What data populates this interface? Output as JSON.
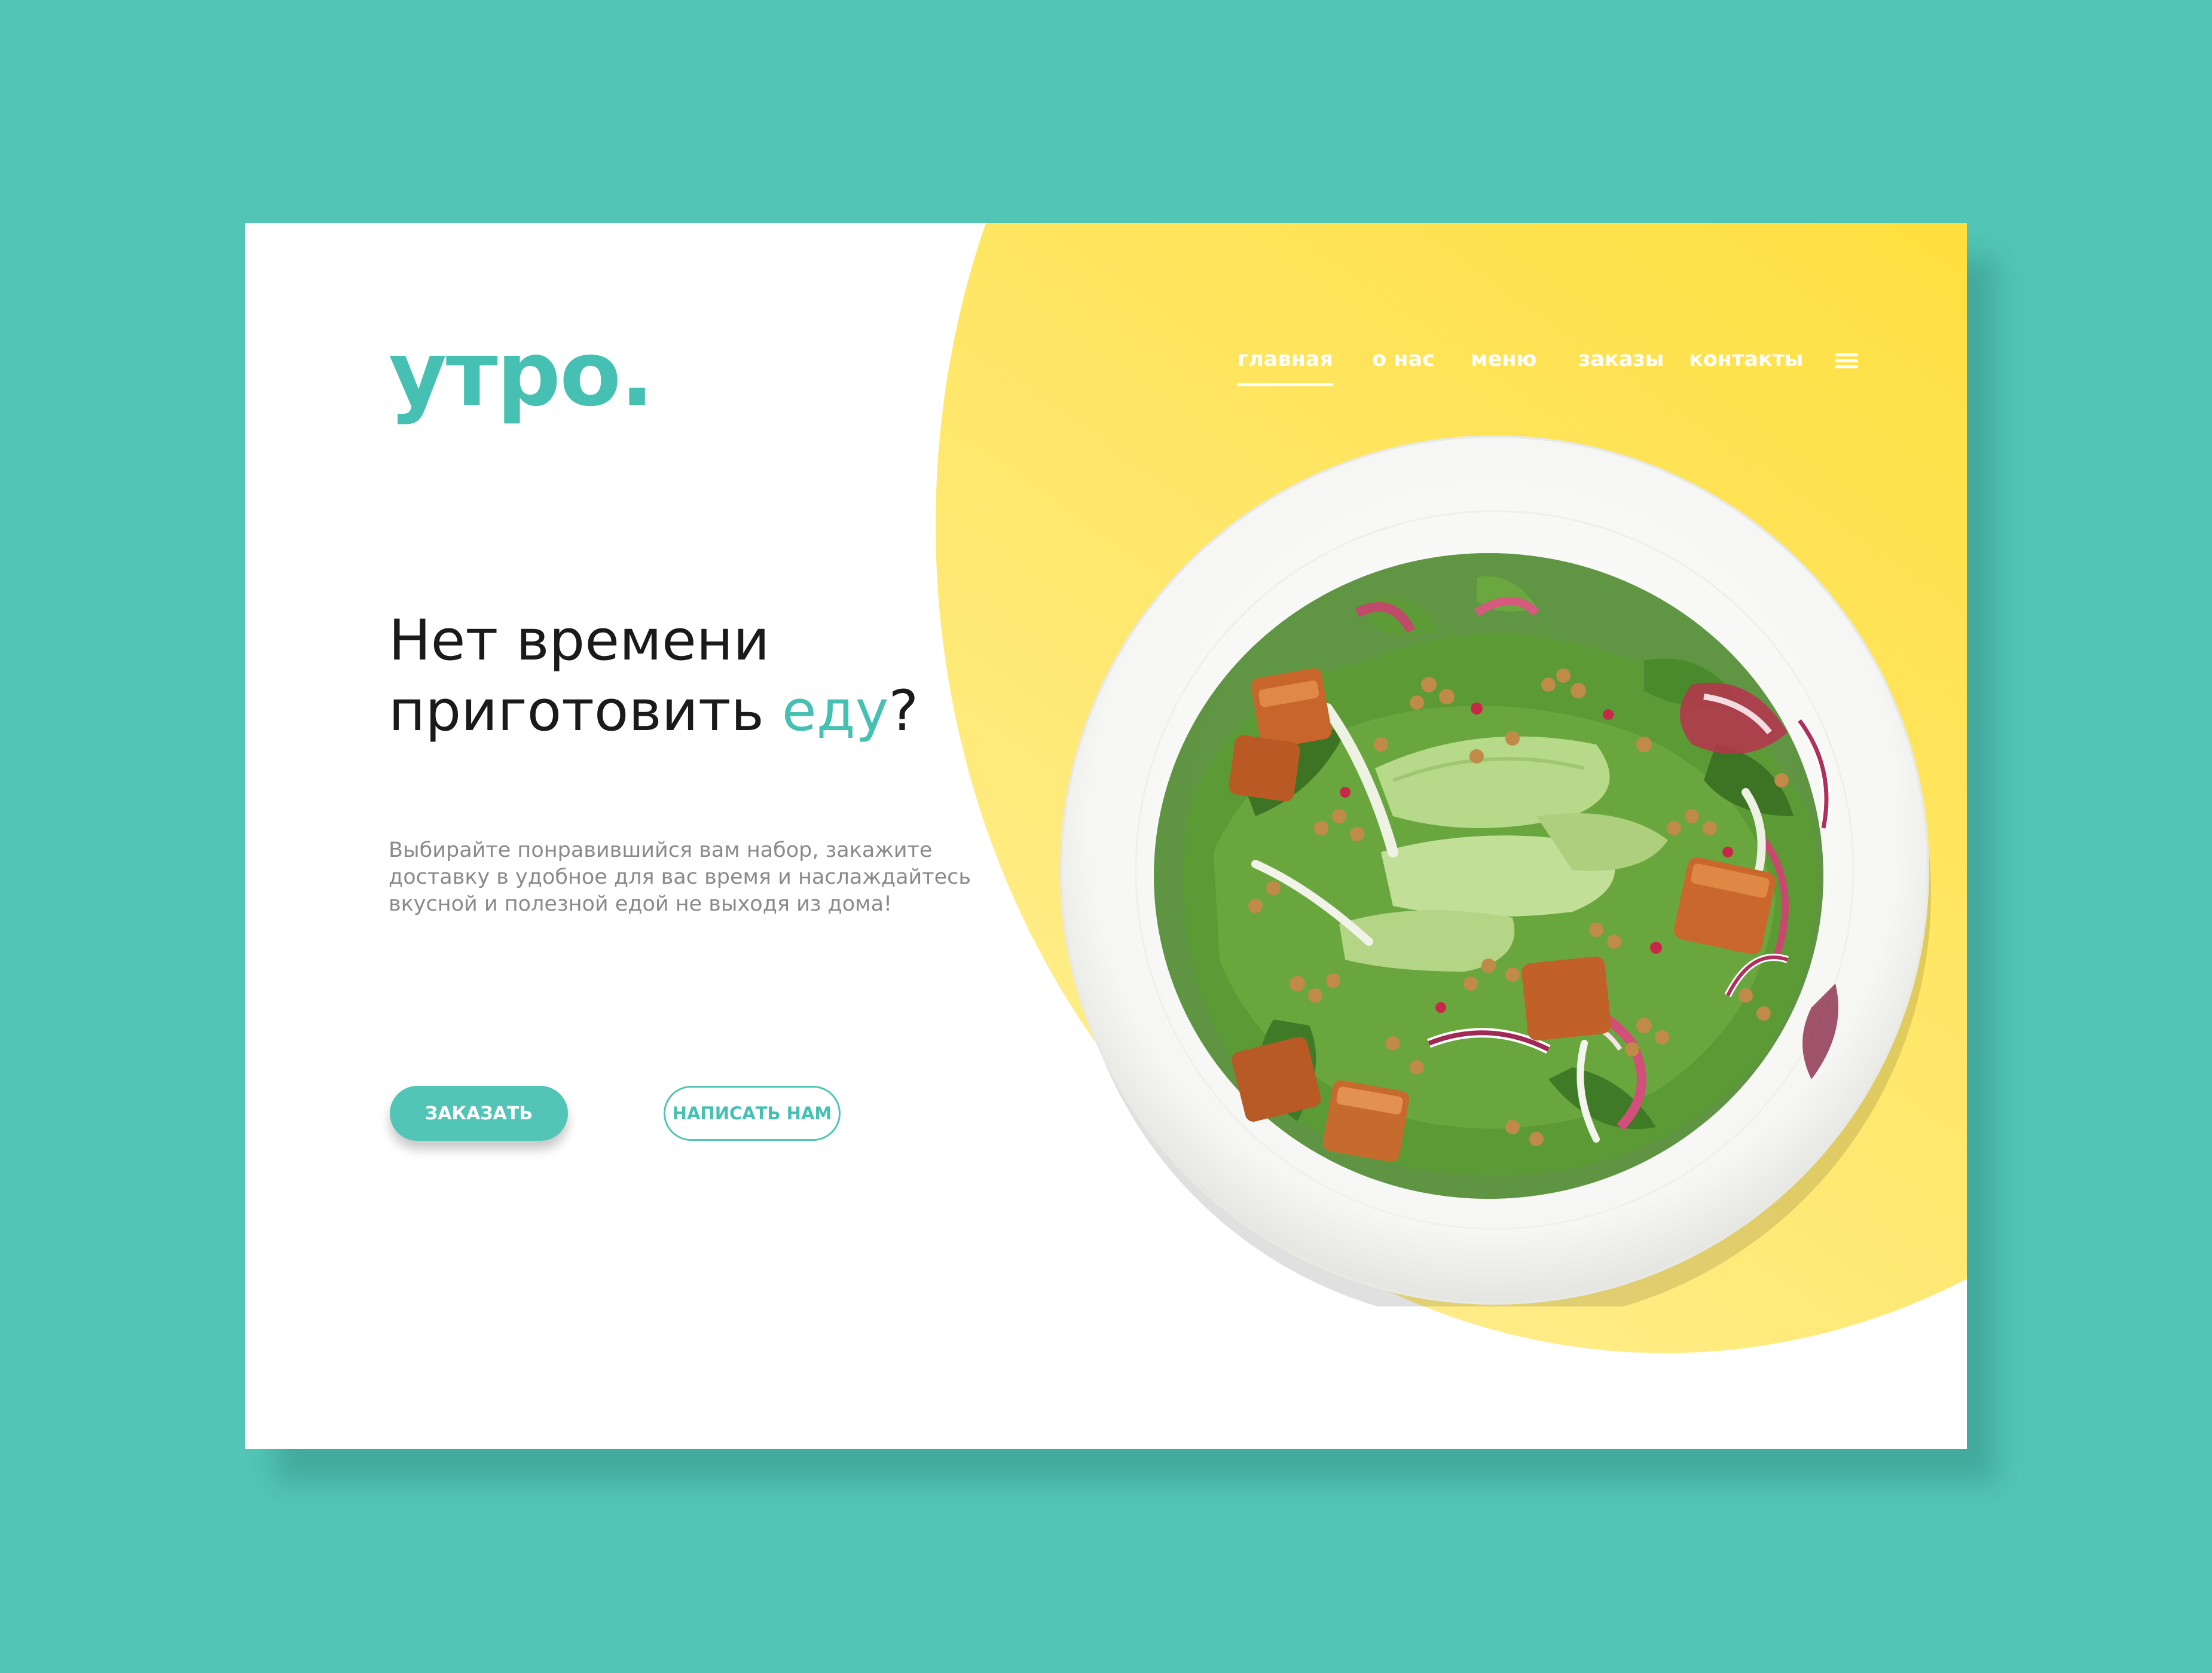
{
  "brand": {
    "logo": "утро."
  },
  "nav": {
    "items": [
      {
        "label": "главная",
        "active": true
      },
      {
        "label": "о нас",
        "active": false
      },
      {
        "label": "меню",
        "active": false
      },
      {
        "label": "заказы",
        "active": false
      },
      {
        "label": "контакты",
        "active": false
      }
    ],
    "menu_icon": "hamburger-menu-icon"
  },
  "hero": {
    "headline_line1": "Нет времени",
    "headline_line2_start": "приготовить ",
    "headline_accent": "еду",
    "headline_end": "?",
    "description": "Выбирайте понравившийся вам набор, закажите доставку в удобное для вас время и наслаждайтесь вкусной и полезной едой не выходя из дома!",
    "primary_button": "ЗАКАЗАТЬ",
    "secondary_button": "НАПИСАТЬ НАМ"
  },
  "colors": {
    "background": "#52c5b7",
    "accent": "#45c0b2",
    "yellow": "#ffd600",
    "card": "#ffffff"
  }
}
